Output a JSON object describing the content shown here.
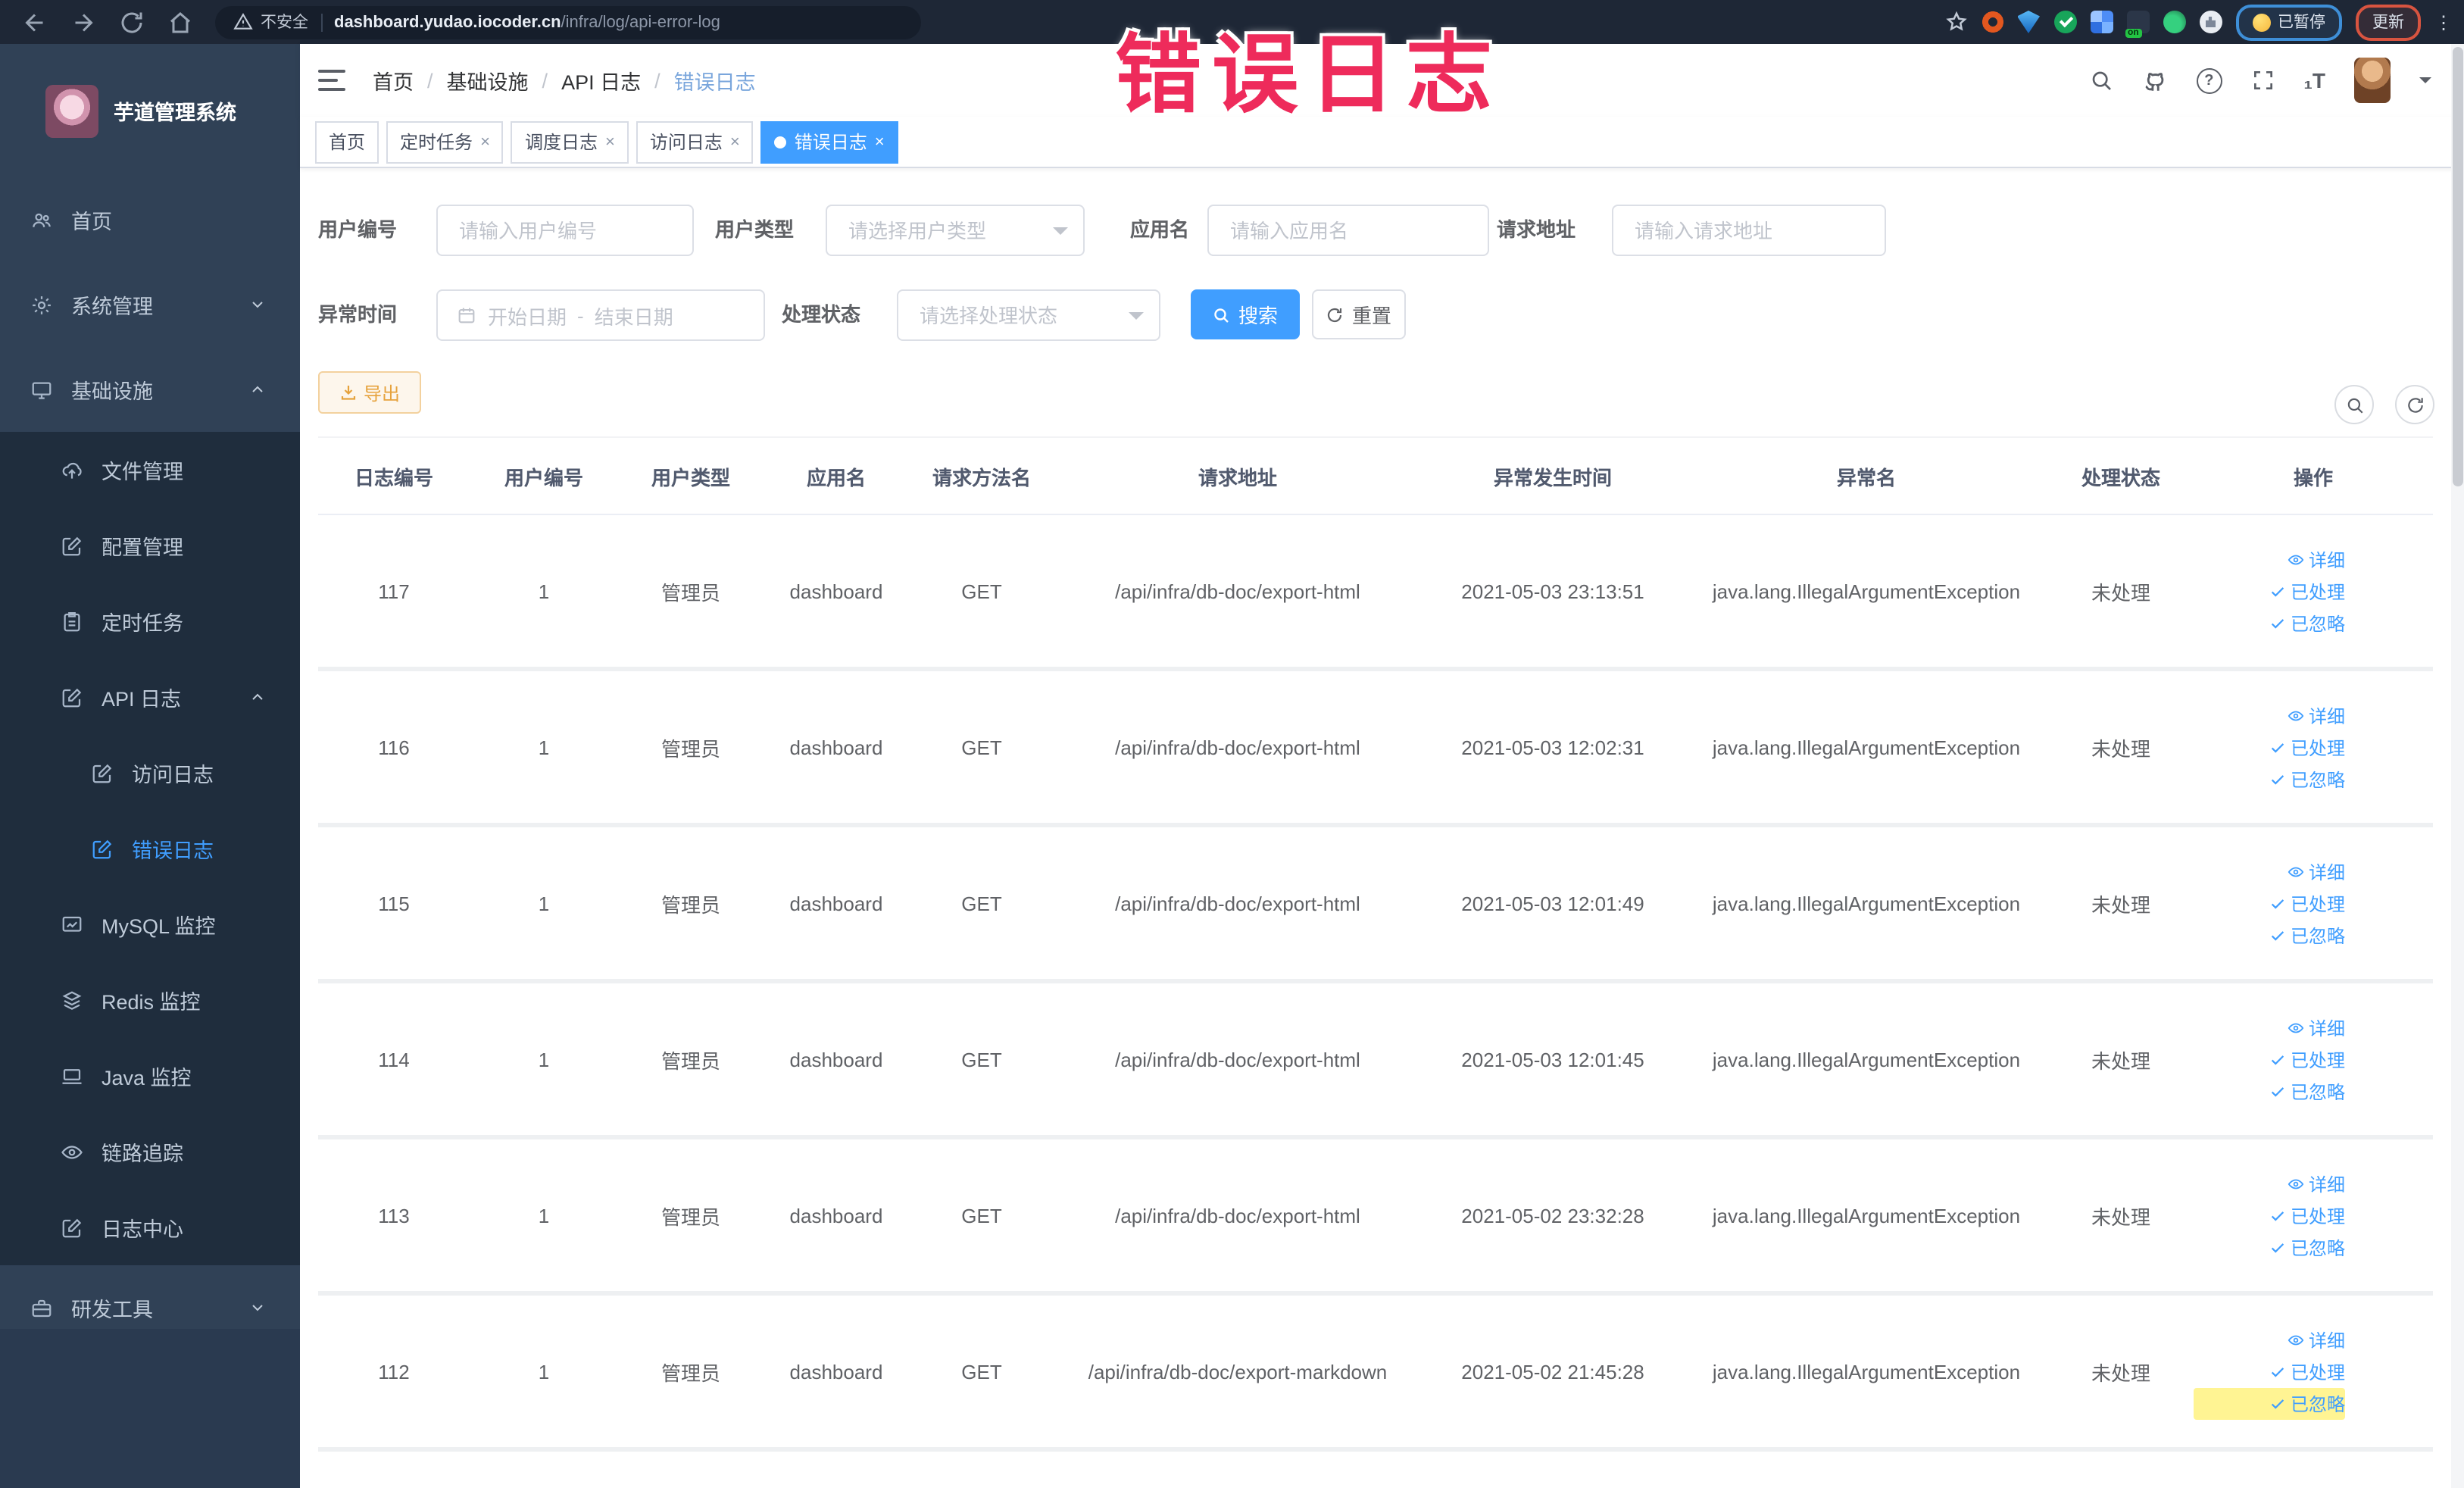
{
  "overlay_title": "错误日志",
  "browser": {
    "security_label": "不安全",
    "url_host": "dashboard.yudao.iocoder.cn",
    "url_path": "/infra/log/api-error-log",
    "paused_label": "已暂停",
    "update_label": "更新"
  },
  "sidebar": {
    "title": "芋道管理系统",
    "items": {
      "home": "首页",
      "system": "系统管理",
      "infra": "基础设施",
      "file": "文件管理",
      "config": "配置管理",
      "job": "定时任务",
      "api_log": "API 日志",
      "access_log": "访问日志",
      "error_log": "错误日志",
      "mysql": "MySQL 监控",
      "redis": "Redis 监控",
      "java": "Java 监控",
      "trace": "链路追踪",
      "log_center": "日志中心",
      "dev_tool": "研发工具"
    }
  },
  "breadcrumb": [
    "首页",
    "基础设施",
    "API 日志",
    "错误日志"
  ],
  "tags": {
    "home": "首页",
    "job": "定时任务",
    "job_log": "调度日志",
    "access_log": "访问日志",
    "error_log": "错误日志"
  },
  "filters": {
    "user_id_label": "用户编号",
    "user_id_placeholder": "请输入用户编号",
    "user_type_label": "用户类型",
    "user_type_placeholder": "请选择用户类型",
    "app_name_label": "应用名",
    "app_name_placeholder": "请输入应用名",
    "request_url_label": "请求地址",
    "request_url_placeholder": "请输入请求地址",
    "time_label": "异常时间",
    "time_start_placeholder": "开始日期",
    "time_separator": "-",
    "time_end_placeholder": "结束日期",
    "status_label": "处理状态",
    "status_placeholder": "请选择处理状态",
    "search_label": "搜索",
    "reset_label": "重置"
  },
  "toolbar": {
    "export_label": "导出"
  },
  "table": {
    "columns": {
      "id": "日志编号",
      "user_id": "用户编号",
      "user_type": "用户类型",
      "app": "应用名",
      "method": "请求方法名",
      "url": "请求地址",
      "time": "异常发生时间",
      "exception": "异常名",
      "status": "处理状态",
      "actions": "操作"
    },
    "action_detail": "详细",
    "action_processed": "已处理",
    "action_ignored": "已忽略",
    "rows": [
      {
        "id": "117",
        "user_id": "1",
        "user_type": "管理员",
        "app": "dashboard",
        "method": "GET",
        "url": "/api/infra/db-doc/export-html",
        "time": "2021-05-03 23:13:51",
        "exception": "java.lang.IllegalArgumentException",
        "status": "未处理"
      },
      {
        "id": "116",
        "user_id": "1",
        "user_type": "管理员",
        "app": "dashboard",
        "method": "GET",
        "url": "/api/infra/db-doc/export-html",
        "time": "2021-05-03 12:02:31",
        "exception": "java.lang.IllegalArgumentException",
        "status": "未处理"
      },
      {
        "id": "115",
        "user_id": "1",
        "user_type": "管理员",
        "app": "dashboard",
        "method": "GET",
        "url": "/api/infra/db-doc/export-html",
        "time": "2021-05-03 12:01:49",
        "exception": "java.lang.IllegalArgumentException",
        "status": "未处理"
      },
      {
        "id": "114",
        "user_id": "1",
        "user_type": "管理员",
        "app": "dashboard",
        "method": "GET",
        "url": "/api/infra/db-doc/export-html",
        "time": "2021-05-03 12:01:45",
        "exception": "java.lang.IllegalArgumentException",
        "status": "未处理"
      },
      {
        "id": "113",
        "user_id": "1",
        "user_type": "管理员",
        "app": "dashboard",
        "method": "GET",
        "url": "/api/infra/db-doc/export-html",
        "time": "2021-05-02 23:32:28",
        "exception": "java.lang.IllegalArgumentException",
        "status": "未处理"
      },
      {
        "id": "112",
        "user_id": "1",
        "user_type": "管理员",
        "app": "dashboard",
        "method": "GET",
        "url": "/api/infra/db-doc/export-markdown",
        "time": "2021-05-02 21:45:28",
        "exception": "java.lang.IllegalArgumentException",
        "status": "未处理"
      }
    ]
  },
  "colors": {
    "accent": "#409eff",
    "sidebar_bg": "#304156",
    "submenu_bg": "#1f2d3d",
    "warning": "#e6a23c",
    "overlay": "#ee2b5b"
  }
}
